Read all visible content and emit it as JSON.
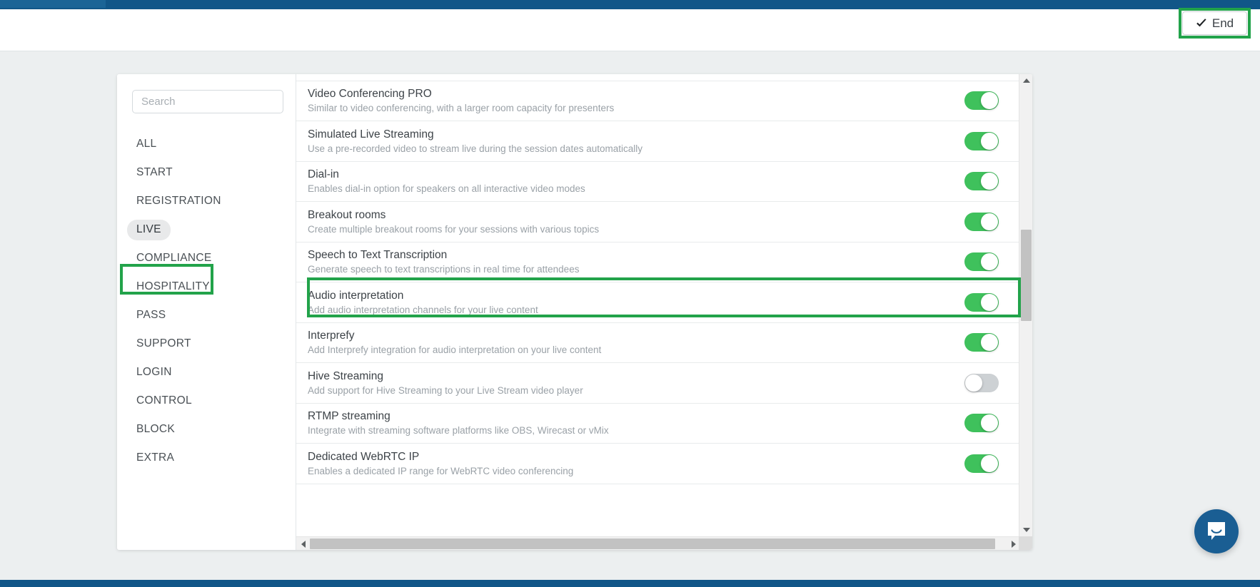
{
  "topbar": {
    "progress_color": "#115688",
    "progress_fill_color": "#1b6496",
    "end_button_label": "End",
    "end_icon": "check-icon"
  },
  "highlight": {
    "color": "#22a34a",
    "targets": [
      "end-button",
      "sidebar-item-live",
      "row-speech-to-text-transcription"
    ]
  },
  "sidebar": {
    "search": {
      "placeholder": "Search",
      "value": ""
    },
    "items": [
      {
        "label": "ALL",
        "active": false
      },
      {
        "label": "START",
        "active": false
      },
      {
        "label": "REGISTRATION",
        "active": false
      },
      {
        "label": "LIVE",
        "active": true
      },
      {
        "label": "COMPLIANCE",
        "active": false
      },
      {
        "label": "HOSPITALITY",
        "active": false
      },
      {
        "label": "PASS",
        "active": false
      },
      {
        "label": "SUPPORT",
        "active": false
      },
      {
        "label": "LOGIN",
        "active": false
      },
      {
        "label": "CONTROL",
        "active": false
      },
      {
        "label": "BLOCK",
        "active": false
      },
      {
        "label": "EXTRA",
        "active": false
      }
    ]
  },
  "feature_list": {
    "rows": [
      {
        "title": "",
        "description": "",
        "toggle": "on",
        "partial": true
      },
      {
        "title": "Video Conferencing PRO",
        "description": "Similar to video conferencing, with a larger room capacity for presenters",
        "toggle": "on"
      },
      {
        "title": "Simulated Live Streaming",
        "description": "Use a pre-recorded video to stream live during the session dates automatically",
        "toggle": "on"
      },
      {
        "title": "Dial-in",
        "description": "Enables dial-in option for speakers on all interactive video modes",
        "toggle": "on"
      },
      {
        "title": "Breakout rooms",
        "description": "Create multiple breakout rooms for your sessions with various topics",
        "toggle": "on"
      },
      {
        "title": "Speech to Text Transcription",
        "description": "Generate speech to text transcriptions in real time for attendees",
        "toggle": "on",
        "highlighted": true
      },
      {
        "title": "Audio interpretation",
        "description": "Add audio interpretation channels for your live content",
        "toggle": "on"
      },
      {
        "title": "Interprefy",
        "description": "Add Interprefy integration for audio interpretation on your live content",
        "toggle": "on"
      },
      {
        "title": "Hive Streaming",
        "description": "Add support for Hive Streaming to your Live Stream video player",
        "toggle": "off"
      },
      {
        "title": "RTMP streaming",
        "description": "Integrate with streaming software platforms like OBS, Wirecast or vMix",
        "toggle": "on"
      },
      {
        "title": "Dedicated WebRTC IP",
        "description": "Enables a dedicated IP range for WebRTC video conferencing",
        "toggle": "on"
      }
    ],
    "toggle_on_color": "#3fc15c",
    "toggle_off_color": "#cdd1d4"
  },
  "scrollbars": {
    "vertical_icon_up": "triangle-up-icon",
    "vertical_icon_down": "triangle-down-icon",
    "horizontal_icon_left": "triangle-left-icon",
    "horizontal_icon_right": "triangle-right-icon"
  },
  "chat_widget": {
    "icon": "chat-bubble-icon",
    "color": "#1a5e93"
  }
}
